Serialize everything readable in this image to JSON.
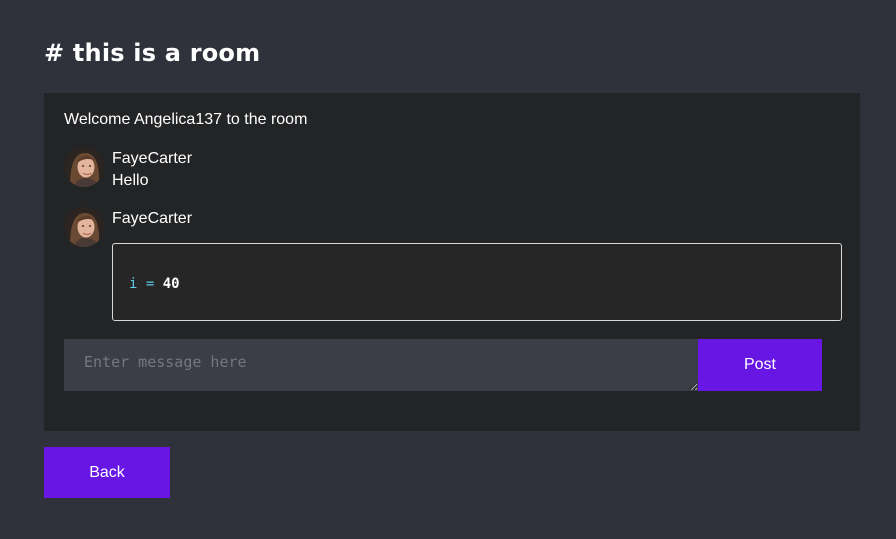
{
  "room": {
    "title": "# this is a room"
  },
  "chat": {
    "welcome": "Welcome Angelica137 to the room",
    "messages": [
      {
        "author": "FayeCarter",
        "avatar_icon": "user-photo-avatar",
        "text": "Hello"
      },
      {
        "author": "FayeCarter",
        "avatar_icon": "user-photo-avatar",
        "code": {
          "var": "i",
          "op": "=",
          "value": "40"
        }
      }
    ]
  },
  "composer": {
    "value": "",
    "placeholder": "Enter message here",
    "post_label": "Post"
  },
  "nav": {
    "back_label": "Back"
  },
  "colors": {
    "background": "#30323b",
    "panel": "#232426",
    "input": "#3b3d47",
    "accent": "#6816e4",
    "code_token": "#5ec8e6"
  }
}
